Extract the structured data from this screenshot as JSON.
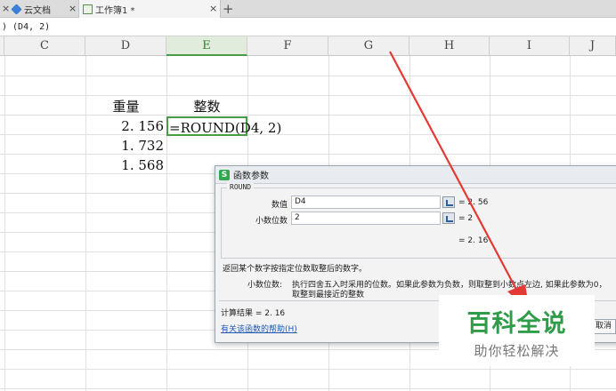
{
  "tabs": [
    {
      "label": "",
      "close": "×"
    },
    {
      "label": "云文档",
      "close": "×"
    },
    {
      "label": "工作簿1 *",
      "close": "×"
    }
  ],
  "tab_add": "+",
  "formula_bar": {
    "text": ") (D4, 2)"
  },
  "columns": [
    "C",
    "D",
    "E",
    "F",
    "G",
    "H",
    "I",
    "J"
  ],
  "cells": {
    "d_header": "重量",
    "e_header": "整数",
    "d5": "2. 156",
    "e5": "=ROUND(D4, 2)",
    "d6": "1. 732",
    "d7": "1. 568"
  },
  "dialog": {
    "title": "函数参数",
    "function_name": "ROUND",
    "args": [
      {
        "label": "数值",
        "value": "D4",
        "result": "= 2. 56"
      },
      {
        "label": "小数位数",
        "value": "2",
        "result": "= 2"
      }
    ],
    "total_preview": "= 2. 16",
    "description": "返回某个数字按指定位数取整后的数字。",
    "param_name": "小数位数:",
    "param_desc_line1": "执行四舍五入时采用的位数。如果此参数为负数，则取整到小数点左边, 如果此参数为0，",
    "param_desc_line2": "取整到最接近的整数",
    "result_label": "计算结果 = 2. 16",
    "help_link": "有关该函数的帮助(H)",
    "cancel_button": "取消"
  },
  "watermark": {
    "main": "百科全说",
    "sub": "助你轻松解决"
  },
  "colors": {
    "accent": "#4a9a48",
    "watermark_green": "#2f9c49",
    "arrow": "#e53935"
  }
}
